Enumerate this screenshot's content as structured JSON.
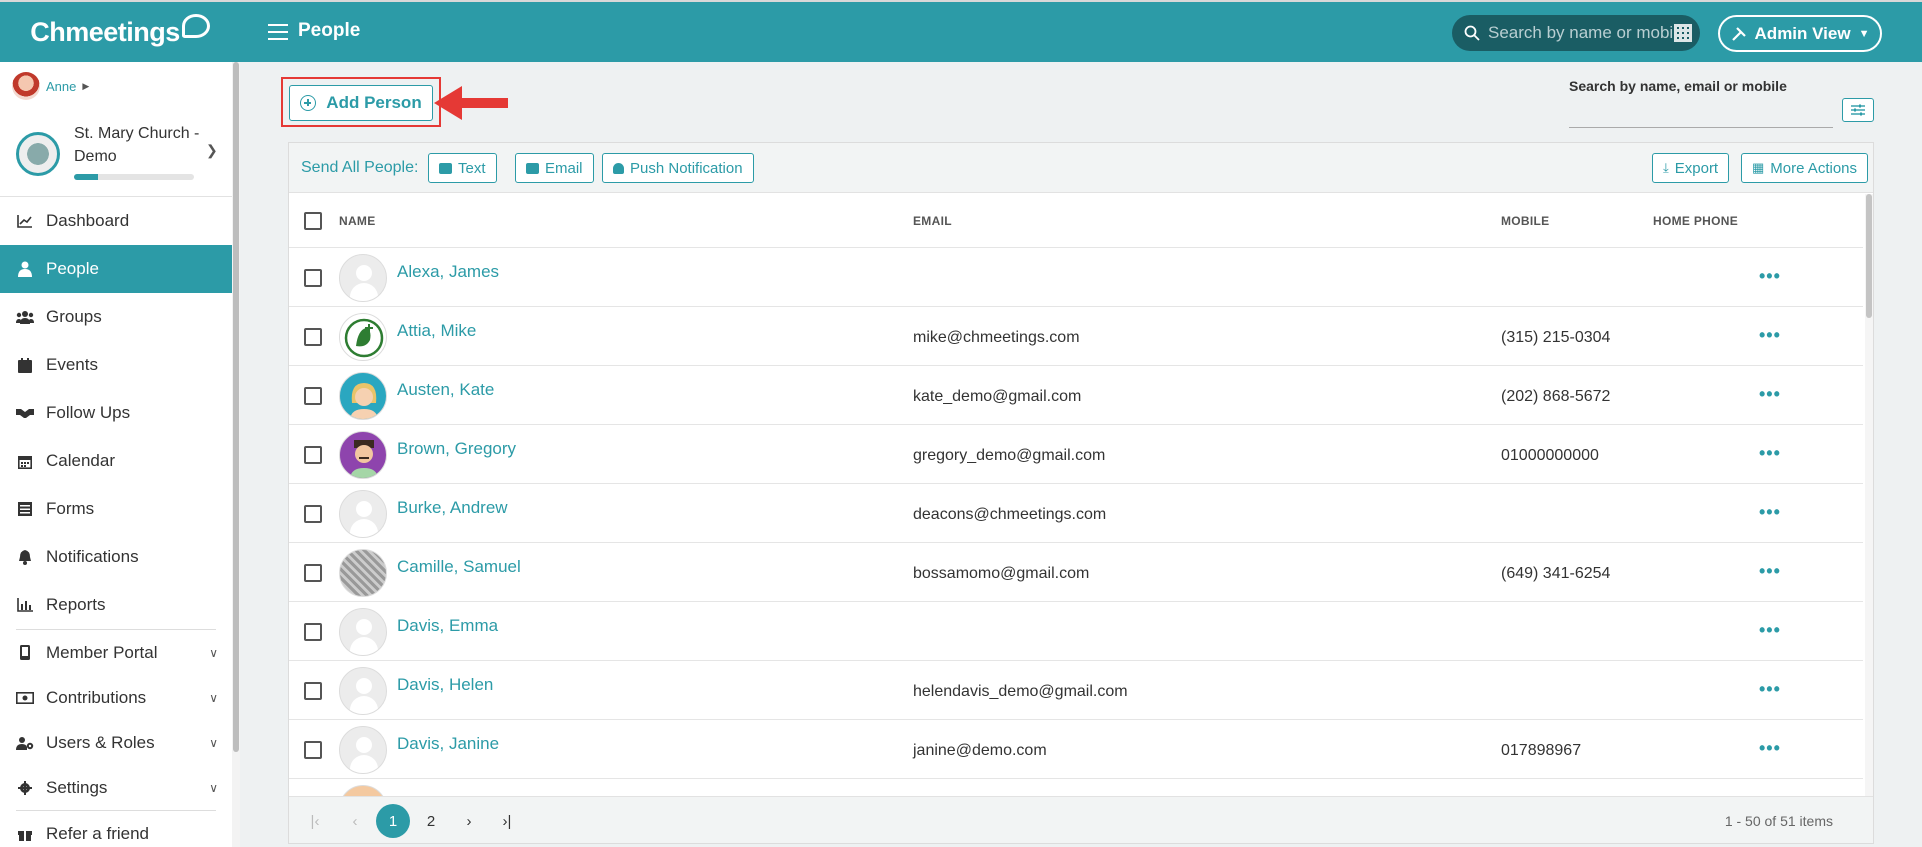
{
  "brand": {
    "name": "Chmeetings"
  },
  "header": {
    "title": "People",
    "search_placeholder": "Search by name or mobile",
    "admin_view": "Admin View"
  },
  "sidebar": {
    "user": "Anne",
    "church_name": "St. Mary Church - Demo",
    "progress_fraction": 0.2,
    "items": [
      {
        "label": "Dashboard",
        "icon": "chart-line-icon"
      },
      {
        "label": "People",
        "icon": "person-icon"
      },
      {
        "label": "Groups",
        "icon": "users-icon"
      },
      {
        "label": "Events",
        "icon": "calendar-icon"
      },
      {
        "label": "Follow Ups",
        "icon": "handshake-icon"
      },
      {
        "label": "Calendar",
        "icon": "calendar-grid-icon"
      },
      {
        "label": "Forms",
        "icon": "list-icon"
      },
      {
        "label": "Notifications",
        "icon": "bell-icon"
      },
      {
        "label": "Reports",
        "icon": "bar-chart-icon"
      },
      {
        "label": "Member Portal",
        "icon": "mobile-icon"
      },
      {
        "label": "Contributions",
        "icon": "money-icon"
      },
      {
        "label": "Users & Roles",
        "icon": "users-cog-icon"
      },
      {
        "label": "Settings",
        "icon": "gear-icon"
      },
      {
        "label": "Refer a friend",
        "icon": "gift-icon"
      }
    ]
  },
  "actions": {
    "add_person": "Add Person",
    "search_label": "Search by name, email or mobile"
  },
  "toolbar": {
    "send_all_label": "Send All People:",
    "text": "Text",
    "email": "Email",
    "push": "Push Notification",
    "export": "Export",
    "more_actions": "More Actions"
  },
  "table": {
    "columns": {
      "name": "NAME",
      "email": "EMAIL",
      "mobile": "MOBILE",
      "home_phone": "HOME PHONE"
    },
    "rows": [
      {
        "name": "Alexa, James",
        "email": "",
        "mobile": "",
        "avatar": "placeholder"
      },
      {
        "name": "Attia, Mike",
        "email": "mike@chmeetings.com",
        "mobile": "(315) 215-0304",
        "avatar": "logo"
      },
      {
        "name": "Austen, Kate",
        "email": "kate_demo@gmail.com",
        "mobile": "(202) 868-5672",
        "avatar": "photo-teal"
      },
      {
        "name": "Brown, Gregory",
        "email": "gregory_demo@gmail.com",
        "mobile": "01000000000",
        "avatar": "photo-purple"
      },
      {
        "name": "Burke, Andrew",
        "email": "deacons@chmeetings.com",
        "mobile": "",
        "avatar": "placeholder"
      },
      {
        "name": "Camille, Samuel",
        "email": "bossamomo@gmail.com",
        "mobile": "(649) 341-6254",
        "avatar": "qr"
      },
      {
        "name": "Davis, Emma",
        "email": "",
        "mobile": "",
        "avatar": "placeholder"
      },
      {
        "name": "Davis, Helen",
        "email": "helendavis_demo@gmail.com",
        "mobile": "",
        "avatar": "placeholder"
      },
      {
        "name": "Davis, Janine",
        "email": "janine@demo.com",
        "mobile": "017898967",
        "avatar": "placeholder"
      }
    ]
  },
  "pager": {
    "pages": [
      "1",
      "2"
    ],
    "current": "1",
    "info": "1 - 50 of 51 items"
  },
  "colors": {
    "accent": "#2c9ba7",
    "highlight": "#e53935"
  }
}
